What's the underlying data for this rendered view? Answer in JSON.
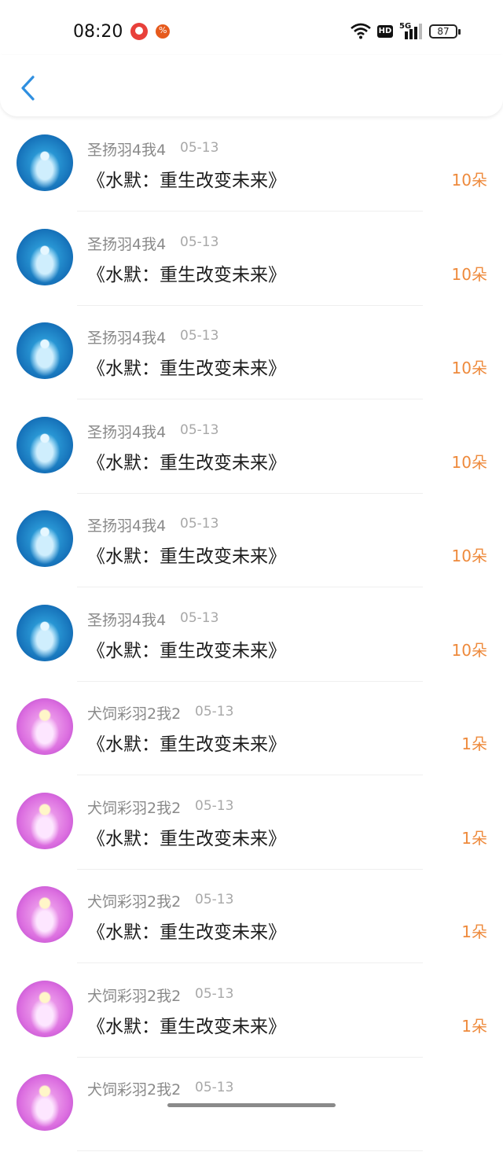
{
  "status_bar": {
    "time": "08:20",
    "network_label": "HD",
    "signal_label": "5G",
    "battery": "87"
  },
  "nav": {
    "back_icon": "chevron-left-icon",
    "accent": "#2f8fe0"
  },
  "colors": {
    "count": "#ee8a3c",
    "user": "#8a8a8a",
    "title": "#1c1c1c"
  },
  "items": [
    {
      "user": "圣扬羽4我4",
      "date": "05-13",
      "title": "《水默：重生改变未来》",
      "count": "10朵",
      "avatar": "blue"
    },
    {
      "user": "圣扬羽4我4",
      "date": "05-13",
      "title": "《水默：重生改变未来》",
      "count": "10朵",
      "avatar": "blue"
    },
    {
      "user": "圣扬羽4我4",
      "date": "05-13",
      "title": "《水默：重生改变未来》",
      "count": "10朵",
      "avatar": "blue"
    },
    {
      "user": "圣扬羽4我4",
      "date": "05-13",
      "title": "《水默：重生改变未来》",
      "count": "10朵",
      "avatar": "blue"
    },
    {
      "user": "圣扬羽4我4",
      "date": "05-13",
      "title": "《水默：重生改变未来》",
      "count": "10朵",
      "avatar": "blue"
    },
    {
      "user": "圣扬羽4我4",
      "date": "05-13",
      "title": "《水默：重生改变未来》",
      "count": "10朵",
      "avatar": "blue"
    },
    {
      "user": "犬饲彩羽2我2",
      "date": "05-13",
      "title": "《水默：重生改变未来》",
      "count": "1朵",
      "avatar": "pink"
    },
    {
      "user": "犬饲彩羽2我2",
      "date": "05-13",
      "title": "《水默：重生改变未来》",
      "count": "1朵",
      "avatar": "pink"
    },
    {
      "user": "犬饲彩羽2我2",
      "date": "05-13",
      "title": "《水默：重生改变未来》",
      "count": "1朵",
      "avatar": "pink"
    },
    {
      "user": "犬饲彩羽2我2",
      "date": "05-13",
      "title": "《水默：重生改变未来》",
      "count": "1朵",
      "avatar": "pink"
    },
    {
      "user": "犬饲彩羽2我2",
      "date": "05-13",
      "title": "",
      "count": "",
      "avatar": "pink"
    }
  ]
}
